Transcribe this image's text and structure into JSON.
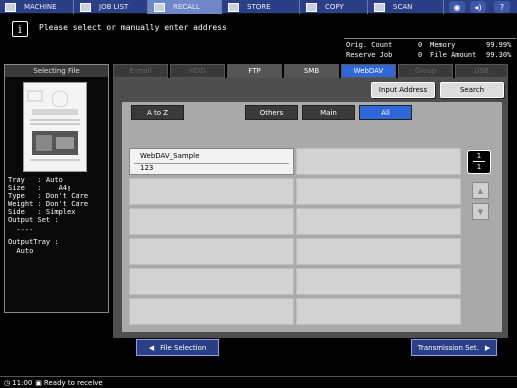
{
  "topbar": {
    "items": [
      {
        "label": "MACHINE",
        "icon": "machine-icon"
      },
      {
        "label": "JOB LIST",
        "icon": "job-list-icon"
      },
      {
        "label": "RECALL",
        "icon": "recall-icon"
      },
      {
        "label": "STORE",
        "icon": "store-icon"
      },
      {
        "label": "COPY",
        "icon": "copy-icon"
      },
      {
        "label": "SCAN",
        "icon": "scan-icon"
      }
    ],
    "help_label": "?"
  },
  "message": {
    "text": "Please select or manually enter address"
  },
  "status_table": {
    "orig_count_label": "Orig. Count",
    "orig_count_value": "0",
    "memory_label": "Memory",
    "memory_value": "99.99%",
    "reserve_job_label": "Reserve Job",
    "reserve_job_value": "0",
    "file_amount_label": "File Amount",
    "file_amount_value": "99.30%"
  },
  "left_panel": {
    "title": "Selecting File",
    "info_lines": [
      "Tray   : Auto",
      "Size   :    A4▯",
      "Type   : Don't Care",
      "Weight : Don't Care",
      "Side   : Simplex",
      "Output Set :",
      "  ----",
      "OutputTray :",
      "  Auto"
    ]
  },
  "tabs": [
    {
      "label": "E-mail",
      "state": "disabled"
    },
    {
      "label": "HDD",
      "state": "disabled"
    },
    {
      "label": "FTP",
      "state": "normal"
    },
    {
      "label": "SMB",
      "state": "normal"
    },
    {
      "label": "WebDAV",
      "state": "active"
    },
    {
      "label": "Group",
      "state": "disabled"
    },
    {
      "label": "USB",
      "state": "disabled"
    }
  ],
  "actions": {
    "input_address": "Input Address",
    "search": "Search"
  },
  "filters": {
    "a_to_z": "A to Z",
    "others": "Others",
    "main": "Main",
    "all": "All"
  },
  "destinations": [
    {
      "name": "WebDAV_Sample",
      "sub": "123"
    }
  ],
  "pager": {
    "current": "1",
    "total": "1"
  },
  "bottom": {
    "file_selection": "File Selection",
    "transmission_set": "Transmission Set."
  },
  "statusbar": {
    "time": "11:00",
    "text": "Ready to receive"
  }
}
